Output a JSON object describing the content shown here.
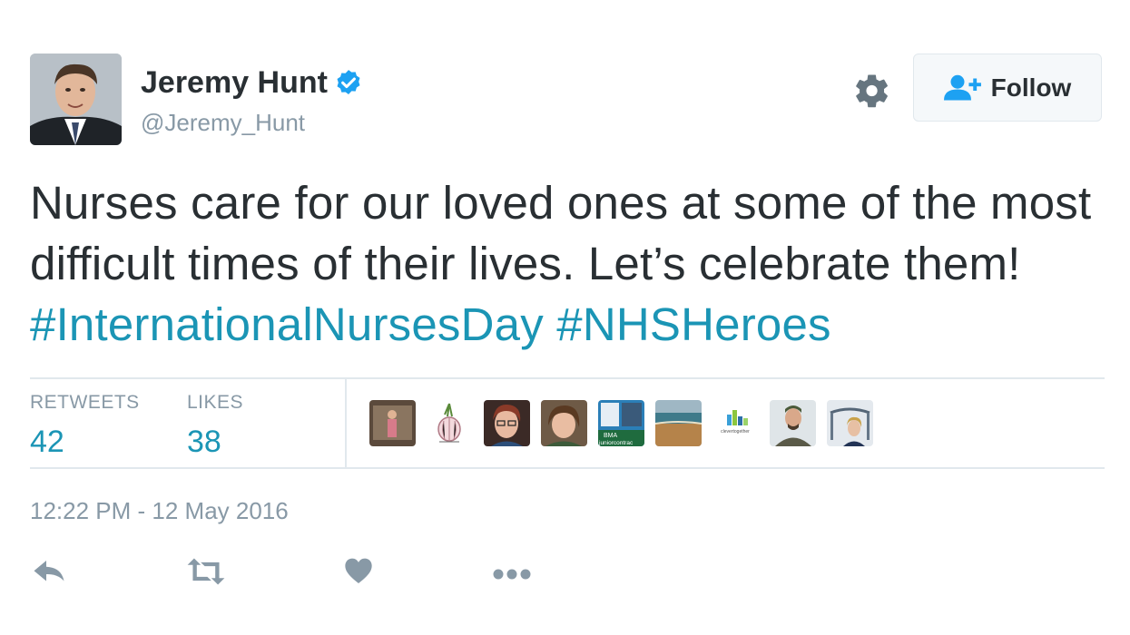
{
  "author": {
    "name": "Jeremy Hunt",
    "handle": "@Jeremy_Hunt",
    "verified": true
  },
  "follow_button": {
    "label": "Follow",
    "icon": "add-user-icon"
  },
  "settings_icon": "gear-icon",
  "tweet": {
    "text": "Nurses care for our loved ones at some of the most difficult times of their lives. Let’s celebrate them!",
    "hashtags": [
      "#InternationalNursesDay",
      "#NHSHeroes"
    ]
  },
  "stats": {
    "retweets_label": "RETWEETS",
    "retweets_value": "42",
    "likes_label": "LIKES",
    "likes_value": "38"
  },
  "liker_avatars": [
    {
      "name": "liker-1",
      "bmatext1": "",
      "bmatext2": ""
    },
    {
      "name": "liker-2",
      "bmatext1": "",
      "bmatext2": ""
    },
    {
      "name": "liker-3",
      "bmatext1": "",
      "bmatext2": ""
    },
    {
      "name": "liker-4",
      "bmatext1": "",
      "bmatext2": ""
    },
    {
      "name": "liker-5",
      "bmatext1": "BMA",
      "bmatext2": "juniorcontrac"
    },
    {
      "name": "liker-6",
      "bmatext1": "",
      "bmatext2": ""
    },
    {
      "name": "liker-7",
      "bmatext1": "clevertogether",
      "bmatext2": ""
    },
    {
      "name": "liker-8",
      "bmatext1": "",
      "bmatext2": ""
    },
    {
      "name": "liker-9",
      "bmatext1": "",
      "bmatext2": ""
    }
  ],
  "timestamp": "12:22 PM - 12 May 2016",
  "actions": [
    "reply-icon",
    "retweet-icon",
    "like-icon",
    "more-icon"
  ],
  "colors": {
    "text": "#292f33",
    "muted": "#8899a6",
    "link": "#1b95b5",
    "verified": "#1da1f2",
    "divider": "#e1e8ed"
  }
}
